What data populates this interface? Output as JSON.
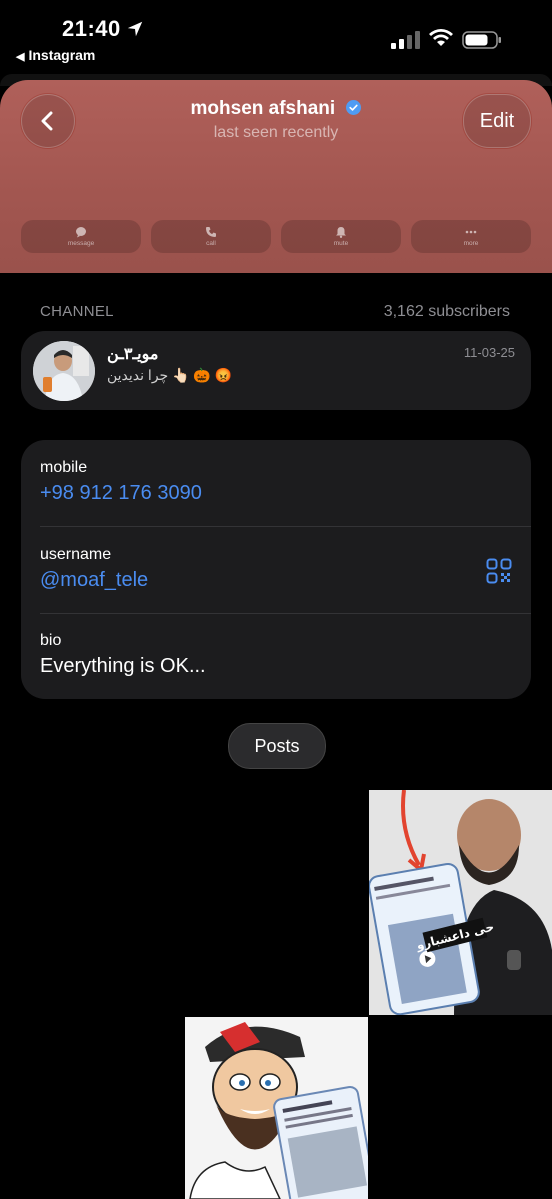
{
  "status_bar": {
    "time": "21:40",
    "back_app": "Instagram"
  },
  "header": {
    "name": "mohsen afshani",
    "subtitle": "last seen recently",
    "edit_label": "Edit",
    "accent_color": "#a85a53",
    "actions": [
      {
        "label": "message",
        "icon": "message-icon"
      },
      {
        "label": "call",
        "icon": "phone-icon"
      },
      {
        "label": "mute",
        "icon": "bell-icon"
      },
      {
        "label": "more",
        "icon": "more-icon"
      }
    ]
  },
  "channel": {
    "section_label": "CHANNEL",
    "subscribers": "3,162 subscribers",
    "title": "مویـ۳ـن",
    "message": "چرا ندیدین 👆🏻 🎃 😡",
    "date": "11-03-25"
  },
  "info": {
    "mobile_label": "mobile",
    "mobile_value": "+98 912 176 3090",
    "username_label": "username",
    "username_value": "@moaf_tele",
    "bio_label": "bio",
    "bio_value": "Everything is OK..."
  },
  "posts": {
    "label": "Posts",
    "post1_caption": "حی داعشبارو"
  }
}
